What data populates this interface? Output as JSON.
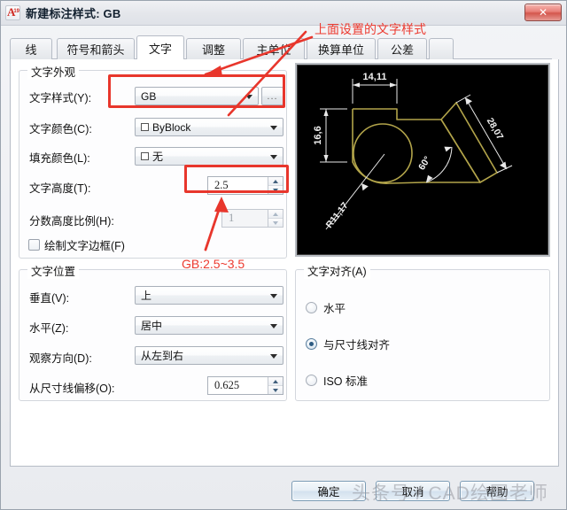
{
  "window": {
    "title": "新建标注样式: GB",
    "app_icon_letter": "A",
    "app_icon_version": "19",
    "close_label": "✕"
  },
  "tabs": [
    {
      "label": "线",
      "active": false
    },
    {
      "label": "符号和箭头",
      "active": false
    },
    {
      "label": "文字",
      "active": true
    },
    {
      "label": "调整",
      "active": false
    },
    {
      "label": "主单位",
      "active": false
    },
    {
      "label": "换算单位",
      "active": false
    },
    {
      "label": "公差",
      "active": false
    }
  ],
  "text_appearance": {
    "legend": "文字外观",
    "style_label": "文字样式(Y):",
    "style_value": "GB",
    "browse_label": "...",
    "color_label": "文字颜色(C):",
    "color_value": "ByBlock",
    "fill_label": "填充颜色(L):",
    "fill_value": "无",
    "height_label": "文字高度(T):",
    "height_value": "2.5",
    "fraction_label": "分数高度比例(H):",
    "fraction_value": "1",
    "frame_label": "绘制文字边框(F)",
    "frame_checked": false
  },
  "text_placement": {
    "legend": "文字位置",
    "vertical_label": "垂直(V):",
    "vertical_value": "上",
    "horizontal_label": "水平(Z):",
    "horizontal_value": "居中",
    "view_label": "观察方向(D):",
    "view_value": "从左到右",
    "offset_label": "从尺寸线偏移(O):",
    "offset_value": "0.625"
  },
  "text_alignment": {
    "legend": "文字对齐(A)",
    "options": [
      {
        "label": "水平",
        "selected": false
      },
      {
        "label": "与尺寸线对齐",
        "selected": true
      },
      {
        "label": "ISO 标准",
        "selected": false
      }
    ]
  },
  "preview": {
    "dim_top": "14,11",
    "dim_left": "16,6",
    "dim_radius": "R11,17",
    "dim_angle": "60°",
    "dim_diagonal": "28,07"
  },
  "footer": {
    "ok_label": "确定",
    "cancel_label": "取消",
    "help_label": "帮助"
  },
  "annotations": {
    "top_note": "上面设置的文字样式",
    "height_note": "GB:2.5~3.5"
  },
  "watermark": {
    "text": "头条号 / CAD绘图老师"
  }
}
